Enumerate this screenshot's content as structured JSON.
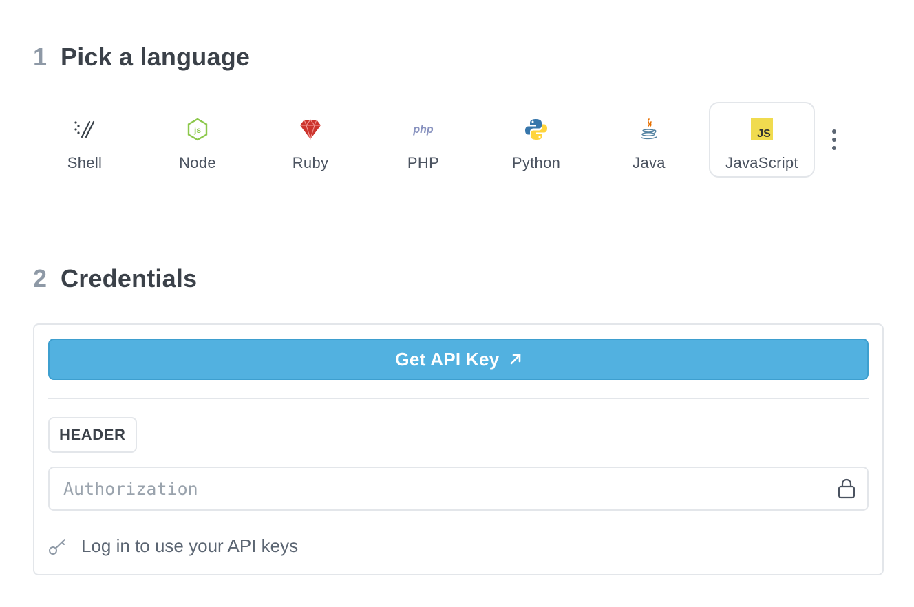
{
  "step1": {
    "number": "1",
    "title": "Pick a language"
  },
  "languages": [
    {
      "name": "Shell",
      "icon": "shell-icon"
    },
    {
      "name": "Node",
      "icon": "node-icon"
    },
    {
      "name": "Ruby",
      "icon": "ruby-icon"
    },
    {
      "name": "PHP",
      "icon": "php-icon"
    },
    {
      "name": "Python",
      "icon": "python-icon"
    },
    {
      "name": "Java",
      "icon": "java-icon"
    },
    {
      "name": "JavaScript",
      "icon": "javascript-icon",
      "selected": true
    }
  ],
  "icon_text": {
    "php": "php",
    "js": "JS"
  },
  "step2": {
    "number": "2",
    "title": "Credentials"
  },
  "credentials": {
    "api_button_label": "Get API Key",
    "header_badge": "HEADER",
    "auth_placeholder": "Authorization",
    "login_text": "Log in to use your API keys"
  },
  "colors": {
    "accent": "#52b1e0",
    "border": "#e3e6ea",
    "node_green": "#8cc84b",
    "ruby_red": "#cc342d",
    "php_purple": "#8892bf",
    "python_blue": "#3776ab",
    "python_yellow": "#ffd43b",
    "js_yellow": "#f0db4f"
  }
}
